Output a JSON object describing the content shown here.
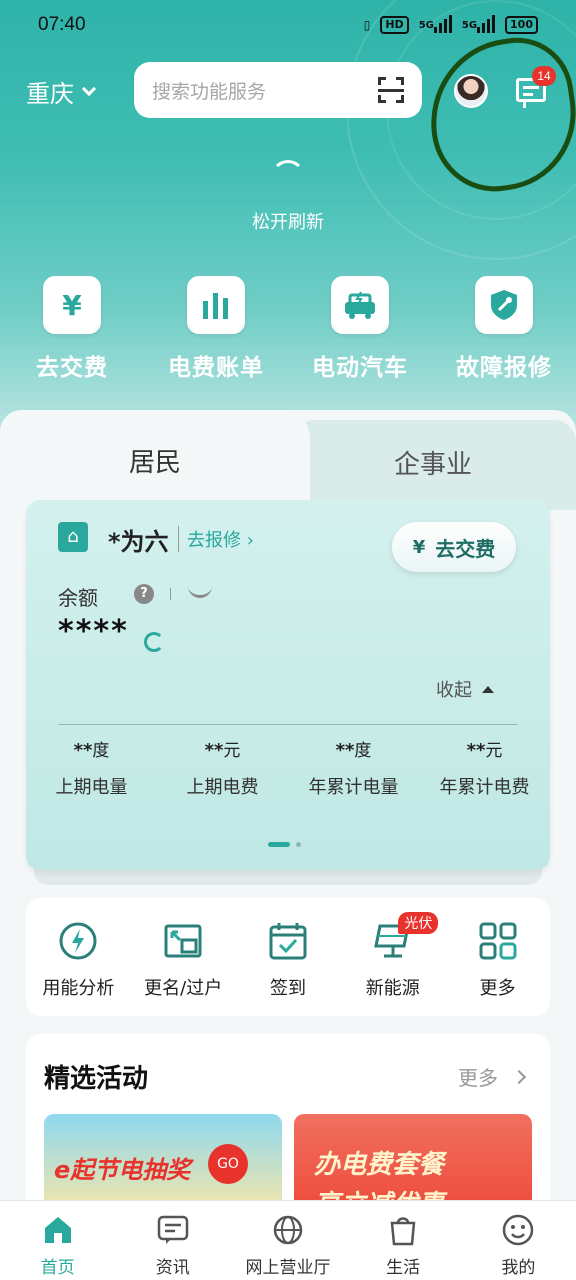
{
  "status_bar": {
    "time": "07:40",
    "hd": "HD",
    "net1": "5G",
    "net2": "5G",
    "battery": "100"
  },
  "header": {
    "city": "重庆",
    "search_placeholder": "搜索功能服务",
    "message_badge": "14"
  },
  "refresh": {
    "text": "松开刷新"
  },
  "quick_actions": [
    {
      "label": "去交费",
      "icon": "yen-icon",
      "glyph": "¥"
    },
    {
      "label": "电费账单",
      "icon": "bar-chart-icon",
      "glyph": "▮▮▮"
    },
    {
      "label": "电动汽车",
      "icon": "ev-car-icon",
      "glyph": "⚡"
    },
    {
      "label": "故障报修",
      "icon": "shield-wrench-icon",
      "glyph": "✚"
    }
  ],
  "tabs": {
    "active": "居民",
    "inactive": "企事业"
  },
  "account": {
    "name": "*为六",
    "repair_link": "去报修 ›",
    "pay_button": "去交费",
    "pay_glyph": "¥",
    "balance_label": "余额",
    "help": "?",
    "balance_value": "****",
    "collapse": "收起",
    "stats": [
      {
        "value": "**",
        "unit": "度",
        "label": "上期电量"
      },
      {
        "value": "**",
        "unit": "元",
        "label": "上期电费"
      },
      {
        "value": "**",
        "unit": "度",
        "label": "年累计电量"
      },
      {
        "value": "**",
        "unit": "元",
        "label": "年累计电费"
      }
    ]
  },
  "services": [
    {
      "label": "用能分析",
      "icon": "energy-analysis-icon"
    },
    {
      "label": "更名/过户",
      "icon": "transfer-icon"
    },
    {
      "label": "签到",
      "icon": "calendar-check-icon"
    },
    {
      "label": "新能源",
      "icon": "solar-panel-icon",
      "badge": "光伏"
    },
    {
      "label": "更多",
      "icon": "grid-icon"
    }
  ],
  "activities": {
    "title": "精选活动",
    "more": "更多",
    "banner1_text": "e起节电抽奖",
    "banner1_go": "GO",
    "banner2_line1": "办电费套餐",
    "banner2_line2": "享立减优惠"
  },
  "bottom_nav": [
    {
      "label": "首页",
      "icon": "home-icon",
      "active": true
    },
    {
      "label": "资讯",
      "icon": "news-icon"
    },
    {
      "label": "网上营业厅",
      "icon": "globe-icon"
    },
    {
      "label": "生活",
      "icon": "bag-icon"
    },
    {
      "label": "我的",
      "icon": "profile-icon"
    }
  ],
  "colors": {
    "accent": "#2aa89d",
    "badge": "#e8322c",
    "hero": "#3fbdb3"
  }
}
